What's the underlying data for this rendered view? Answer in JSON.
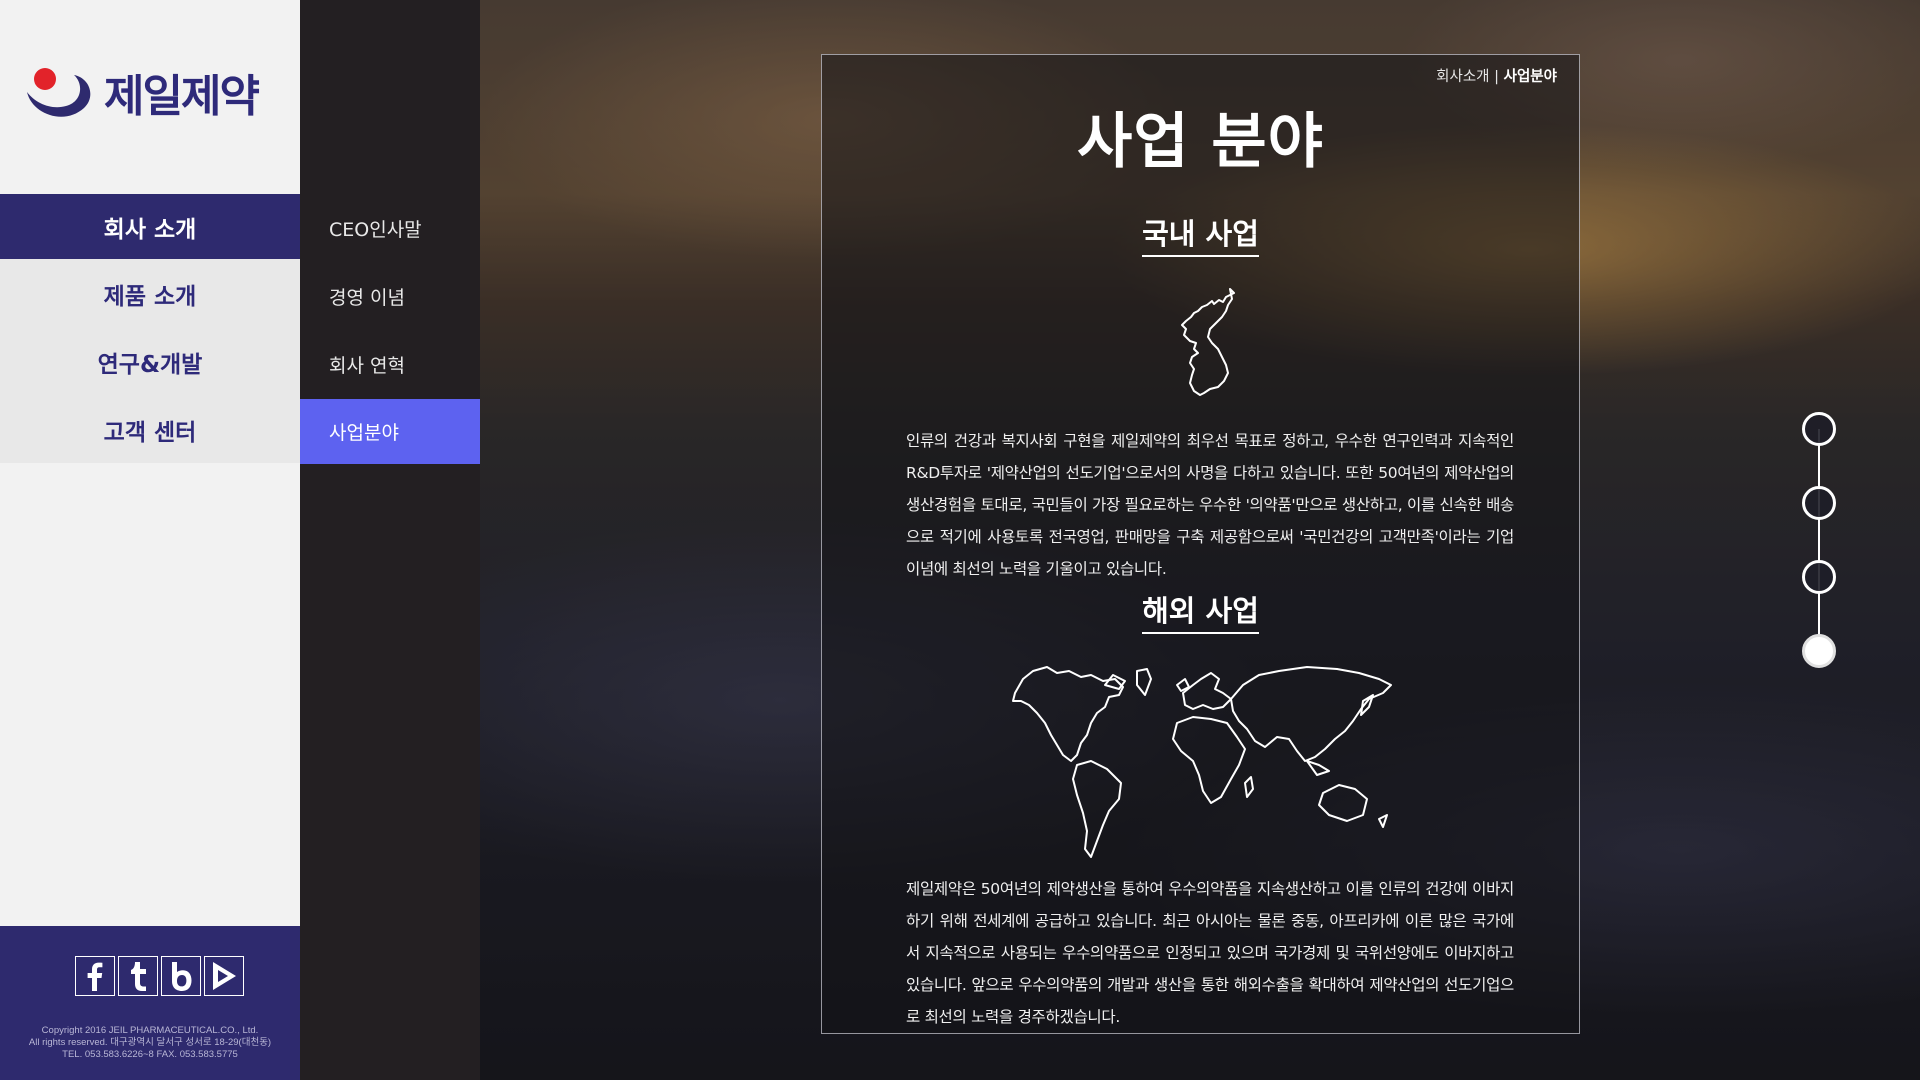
{
  "logo": {
    "text": "제일제약"
  },
  "main_nav": [
    {
      "label": "회사 소개",
      "active": true
    },
    {
      "label": "제품 소개",
      "active": false
    },
    {
      "label": "연구&개발",
      "active": false
    },
    {
      "label": "고객 센터",
      "active": false
    }
  ],
  "sub_nav": [
    {
      "label": "CEO인사말",
      "active": false
    },
    {
      "label": "경영 이념",
      "active": false
    },
    {
      "label": "회사 연혁",
      "active": false
    },
    {
      "label": "사업분야",
      "active": true
    }
  ],
  "footer": {
    "social": [
      "facebook-icon",
      "tumblr-icon",
      "blogger-icon",
      "youtube-icon"
    ],
    "copyright_line1": "Copyright 2016 JEIL PHARMACEUTICAL.CO., Ltd.",
    "copyright_line2": "All rights reserved. 대구광역시 달서구 성서로 18-29(대천동)",
    "copyright_line3": "TEL. 053.583.6226~8 FAX. 053.583.5775"
  },
  "breadcrumb": {
    "parent": "회사소개",
    "separator": " | ",
    "current": "사업분야"
  },
  "page_title": "사업 분야",
  "domestic": {
    "title": "국내 사업",
    "icon": "korea-map-icon",
    "text": "인류의 건강과 복지사회 구현을 제일제약의 최우선 목표로 정하고, 우수한 연구인력과 지속적인 R&D투자로 '제약산업의 선도기업'으로서의 사명을 다하고 있습니다. 또한 50여년의 제약산업의 생산경험을 토대로, 국민들이 가장 필요로하는 우수한 '의약품'만으로 생산하고, 이를 신속한 배송으로 적기에 사용토록 전국영업, 판매망을 구축 제공함으로써 '국민건강의 고객만족'이라는 기업이념에 최선의 노력을 기울이고 있습니다."
  },
  "overseas": {
    "title": "해외 사업",
    "icon": "world-map-icon",
    "text": "제일제약은 50여년의 제약생산을 통하여 우수의약품을 지속생산하고 이를 인류의 건강에 이바지하기 위해 전세계에 공급하고 있습니다. 최근 아시아는 물론 중동, 아프리카에 이른 많은 국가에서 지속적으로 사용되는 우수의약품으로 인정되고 있으며 국가경제 및 국위선양에도 이바지하고 있습니다. 앞으로 우수의약품의 개발과 생산을 통한 해외수출을 확대하여 제약산업의 선도기업으로 최선의 노력을 경주하겠습니다."
  },
  "page_indicator": {
    "total": 4,
    "active_index": 3
  },
  "colors": {
    "brand_navy": "#2e2a6e",
    "sub_dark": "#231f22",
    "sub_active": "#5d62f0",
    "logo_red": "#e2232a"
  }
}
